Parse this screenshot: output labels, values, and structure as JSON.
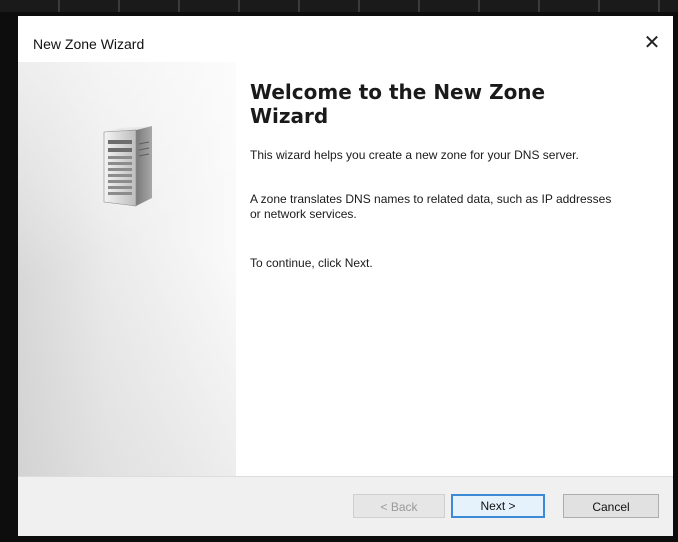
{
  "window": {
    "title": "New Zone Wizard",
    "close_glyph": "✕"
  },
  "welcome": {
    "heading": "Welcome to the New Zone Wizard",
    "paragraph1": "This wizard helps you create a new zone for your DNS server.",
    "paragraph2": "A zone translates DNS names to related data, such as IP addresses or network services.",
    "paragraph3": "To continue, click Next."
  },
  "side_panel": {
    "icon": "server-tower-icon"
  },
  "buttons": {
    "back_label": "< Back",
    "back_enabled": false,
    "next_label": "Next >",
    "cancel_label": "Cancel"
  }
}
